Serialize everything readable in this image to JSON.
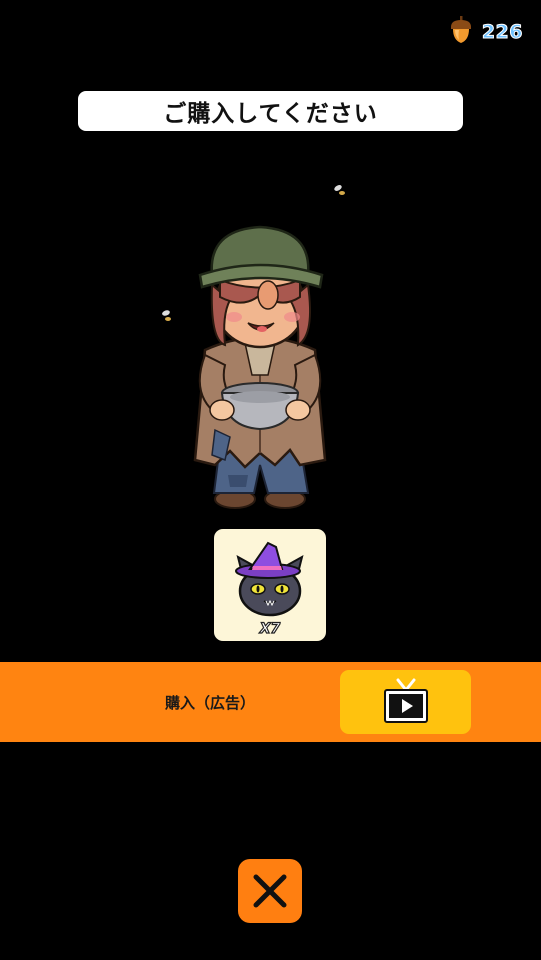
{
  "header": {
    "currency_icon": "acorn-icon",
    "currency_value": "226"
  },
  "dialog": {
    "title": "ご購入してください"
  },
  "item": {
    "icon": "witch-cat-icon",
    "quantity": "X7"
  },
  "purchase": {
    "label": "購入（広告）",
    "button_icon": "tv-play-icon"
  },
  "close": {
    "icon": "close-icon"
  },
  "colors": {
    "background": "#000000",
    "orange_bar": "#ff8411",
    "ad_button": "#ffc20e",
    "close_button": "#ff7f11",
    "currency_text": "#6fc2ff"
  }
}
